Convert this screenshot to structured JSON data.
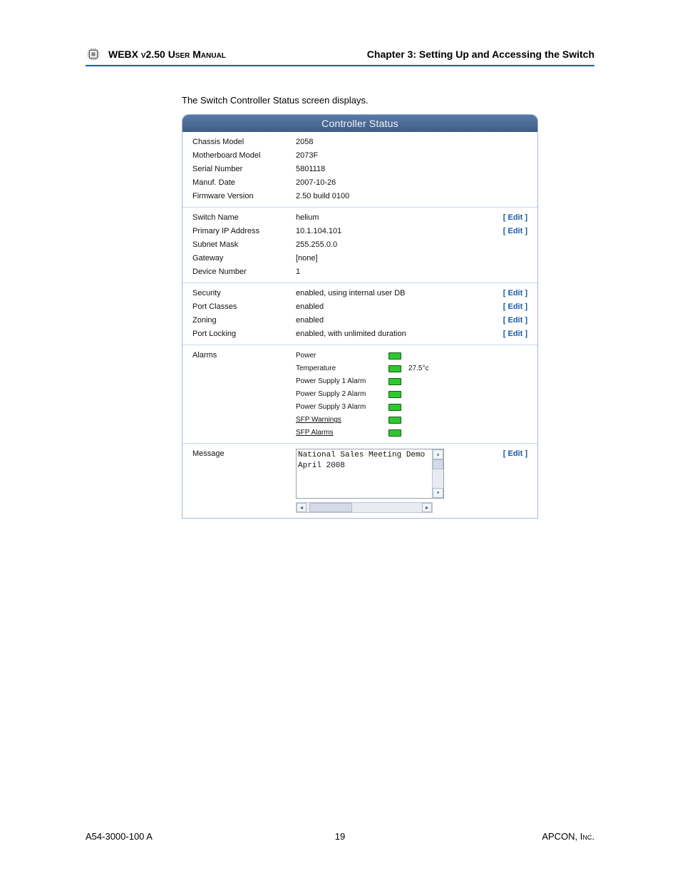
{
  "header": {
    "manualTitle": "WEBX v2.50 User Manual",
    "chapterTitle": "Chapter 3: Setting Up and Accessing the Switch"
  },
  "intro": "The Switch Controller Status screen displays.",
  "panel": {
    "title": "Controller Status",
    "editLabel": "[ Edit ]",
    "section1": [
      {
        "label": "Chassis Model",
        "value": "2058"
      },
      {
        "label": "Motherboard Model",
        "value": "2073F"
      },
      {
        "label": "Serial Number",
        "value": "5801118"
      },
      {
        "label": "Manuf. Date",
        "value": "2007-10-26"
      },
      {
        "label": "Firmware Version",
        "value": "2.50 build 0100"
      }
    ],
    "section2": [
      {
        "label": "Switch Name",
        "value": "helium",
        "edit": true
      },
      {
        "label": "Primary IP Address",
        "value": "10.1.104.101",
        "edit": true
      },
      {
        "label": "Subnet Mask",
        "value": "255.255.0.0"
      },
      {
        "label": "Gateway",
        "value": "[none]"
      },
      {
        "label": "Device Number",
        "value": "1"
      }
    ],
    "section3": [
      {
        "label": "Security",
        "value": "enabled, using internal user DB",
        "edit": true
      },
      {
        "label": "Port Classes",
        "value": "enabled",
        "edit": true
      },
      {
        "label": "Zoning",
        "value": "enabled",
        "edit": true
      },
      {
        "label": "Port Locking",
        "value": "enabled, with unlimited duration",
        "edit": true
      }
    ],
    "alarms": {
      "label": "Alarms",
      "items": [
        {
          "name": "Power",
          "extra": ""
        },
        {
          "name": "Temperature",
          "extra": "27.5°c"
        },
        {
          "name": "Power Supply 1 Alarm",
          "extra": ""
        },
        {
          "name": "Power Supply 2 Alarm",
          "extra": ""
        },
        {
          "name": "Power Supply 3 Alarm",
          "extra": ""
        },
        {
          "name": "SFP Warnings",
          "extra": "",
          "underline": true
        },
        {
          "name": "SFP Alarms",
          "extra": "",
          "underline": true
        }
      ]
    },
    "message": {
      "label": "Message",
      "text": "National Sales Meeting Demo\nApril 2008",
      "edit": true
    }
  },
  "footer": {
    "left": "A54-3000-100 A",
    "center": "19",
    "right": "APCON, Inc."
  }
}
